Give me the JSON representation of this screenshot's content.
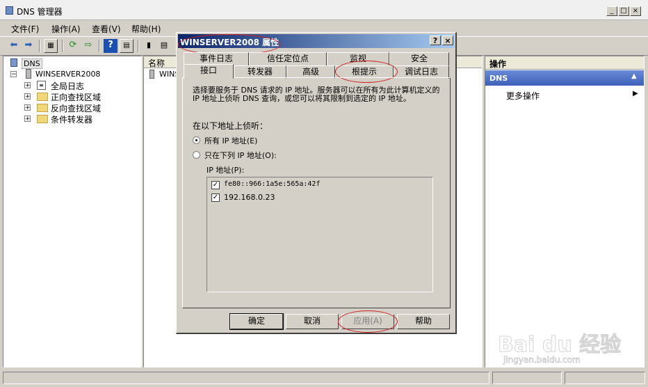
{
  "window": {
    "title": "DNS 管理器"
  },
  "menu": [
    "文件(F)",
    "操作(A)",
    "查看(V)",
    "帮助(H)"
  ],
  "tree": {
    "root": "DNS",
    "server": "WINSERVER2008",
    "children": [
      "全局日志",
      "正向查找区域",
      "反向查找区域",
      "条件转发器"
    ]
  },
  "list": {
    "column_name": "名称",
    "row_text": "WINS"
  },
  "actions": {
    "title": "操作",
    "section": "DNS",
    "more": "更多操作"
  },
  "dialog": {
    "title": "WINSERVER2008 属性",
    "help_btn": "?",
    "close_btn": "×",
    "tabs_row1": [
      "事件日志",
      "信任定位点",
      "监视",
      "安全"
    ],
    "tabs_row2": [
      "接口",
      "转发器",
      "高级",
      "根提示",
      "调试日志"
    ],
    "description": "选择要服务于 DNS 请求的 IP 地址。服务器可以在所有为此计算机定义的 IP 地址上侦听 DNS 查询，或您可以将其限制到选定的 IP 地址。",
    "listen_label": "在以下地址上侦听：",
    "radio_all": "所有 IP 地址(E)",
    "radio_only": "只在下列 IP 地址(O):",
    "ip_label": "IP 地址(P):",
    "ips": [
      "fe80::966:1a5e:565a:42f",
      "192.168.0.23"
    ],
    "buttons": {
      "ok": "确定",
      "cancel": "取消",
      "apply": "应用(A)",
      "help": "帮助"
    }
  },
  "watermark": {
    "brand": "Bai du 经验",
    "url": "jingyan.baidu.com"
  }
}
